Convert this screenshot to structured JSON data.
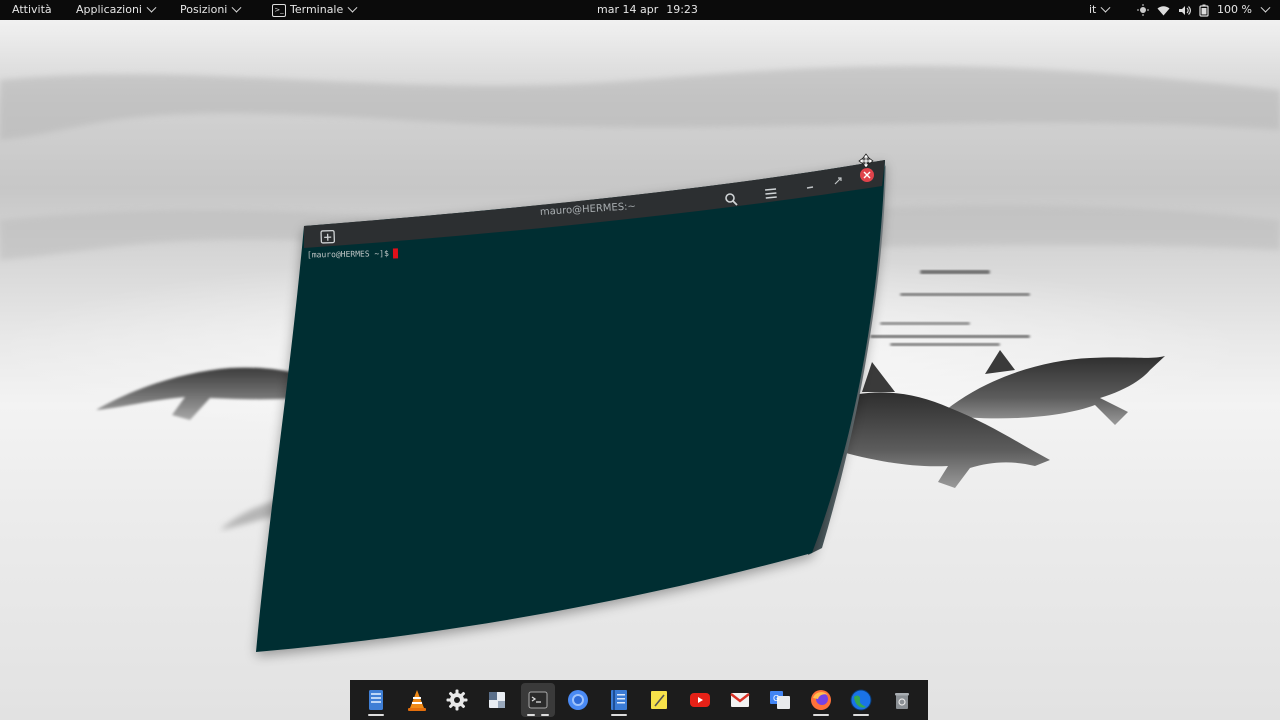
{
  "topbar": {
    "activities": "Attività",
    "applications": "Applicazioni",
    "places": "Posizioni",
    "app_menu": "Terminale",
    "date": "mar 14 apr",
    "time": "19:23",
    "keyboard_layout": "it",
    "battery": "100 %"
  },
  "terminal": {
    "title": "mauro@HERMES:~",
    "prompt": "[mauro@HERMES ~]$",
    "bg_color": "#062d32"
  },
  "dock": {
    "items": [
      {
        "name": "files",
        "icon": "files-icon",
        "running": true
      },
      {
        "name": "vlc",
        "icon": "vlc-icon",
        "running": false
      },
      {
        "name": "settings",
        "icon": "gear-icon",
        "running": false
      },
      {
        "name": "screenshot",
        "icon": "screenshot-icon",
        "running": false
      },
      {
        "name": "terminal",
        "icon": "terminal-icon",
        "running": true,
        "active": true
      },
      {
        "name": "chrome",
        "icon": "chrome-icon",
        "running": false
      },
      {
        "name": "text-editor",
        "icon": "text-editor-icon",
        "running": true
      },
      {
        "name": "notes",
        "icon": "notes-icon",
        "running": false
      },
      {
        "name": "youtube",
        "icon": "youtube-icon",
        "running": false
      },
      {
        "name": "gmail",
        "icon": "gmail-icon",
        "running": false
      },
      {
        "name": "translate",
        "icon": "translate-icon",
        "running": false
      },
      {
        "name": "firefox",
        "icon": "firefox-icon",
        "running": true
      },
      {
        "name": "earth",
        "icon": "earth-icon",
        "running": true
      },
      {
        "name": "trash",
        "icon": "trash-icon",
        "running": false
      }
    ]
  }
}
